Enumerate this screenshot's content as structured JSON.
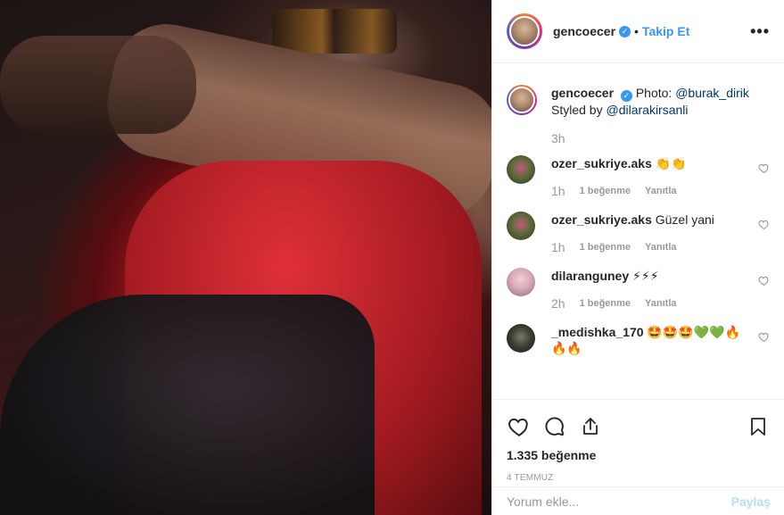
{
  "post_header": {
    "username": "gencoecer",
    "verified_icon": "verified-badge-icon",
    "separator": "•",
    "follow_label": "Takip Et",
    "more_icon": "more-options-icon"
  },
  "caption": {
    "username": "gencoecer",
    "text_prefix": "Photo: ",
    "mention1": "@burak_dirik",
    "text_mid": "Styled by ",
    "mention2": "@dilarakirsanli",
    "time": "3h"
  },
  "comments": [
    {
      "username": "ozer_sukriye.aks",
      "text": "👏👏",
      "time": "1h",
      "likes": "1 beğenme",
      "reply": "Yanıtla"
    },
    {
      "username": "ozer_sukriye.aks",
      "text": "Güzel yani",
      "time": "1h",
      "likes": "1 beğenme",
      "reply": "Yanıtla"
    },
    {
      "username": "dilaranguney",
      "text": "⚡⚡⚡",
      "time": "2h",
      "likes": "1 beğenme",
      "reply": "Yanıtla"
    },
    {
      "username": "_medishka_170",
      "text": "🤩🤩🤩💚💚🔥🔥🔥",
      "time": "",
      "likes": "",
      "reply": ""
    }
  ],
  "actions": {
    "like_icon": "heart-icon",
    "comment_icon": "comment-icon",
    "share_icon": "share-icon",
    "save_icon": "bookmark-icon",
    "likes_count": "1.335 beğenme",
    "date": "4 TEMMUZ"
  },
  "comment_box": {
    "placeholder": "Yorum ekle...",
    "post_label": "Paylaş"
  },
  "colors": {
    "link_blue": "#3897f0",
    "text": "#262626",
    "muted": "#999999",
    "post_disabled": "#b2dffc"
  }
}
